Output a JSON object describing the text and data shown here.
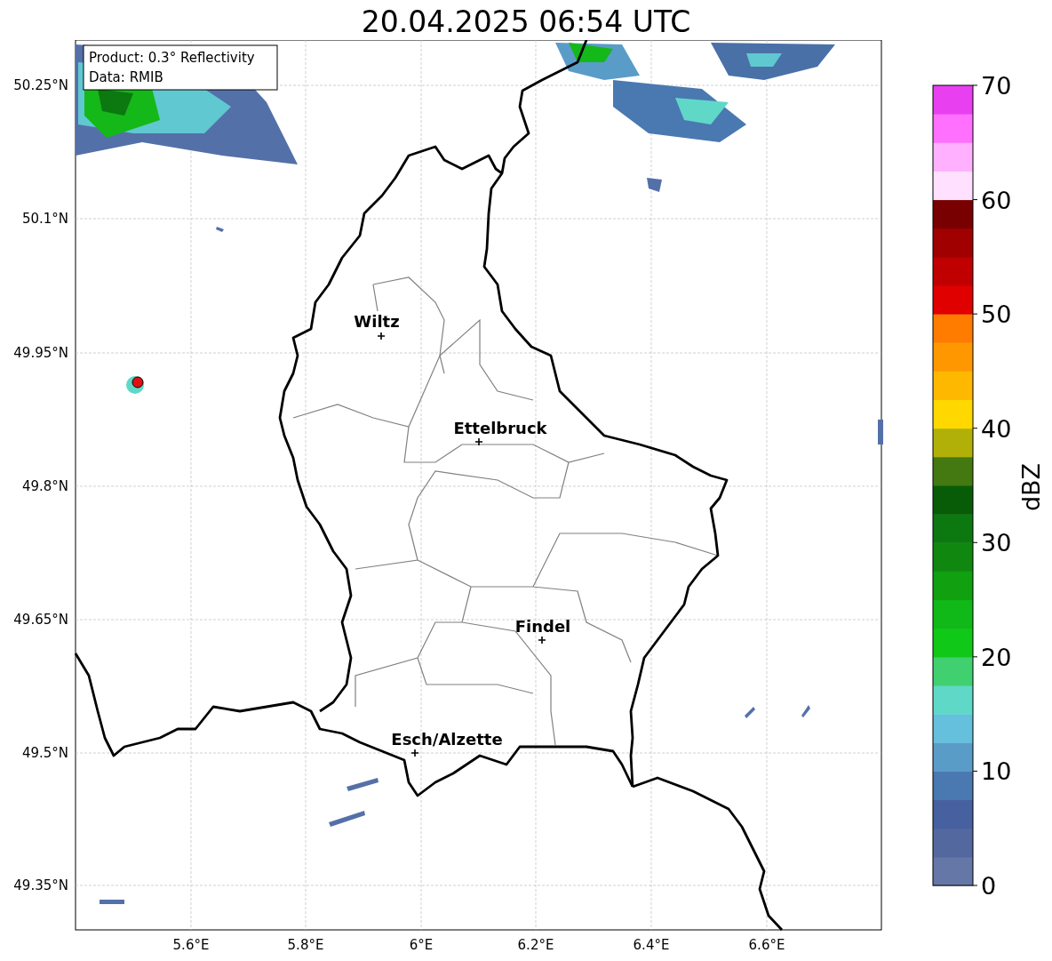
{
  "title": "20.04.2025 06:54 UTC",
  "info_box": [
    "Product: 0.3° Reflectivity",
    "Data: RMIB"
  ],
  "map": {
    "y_ticks": [
      "50.25°N",
      "50.1°N",
      "49.95°N",
      "49.8°N",
      "49.65°N",
      "49.5°N",
      "49.35°N"
    ],
    "x_ticks": [
      "5.6°E",
      "5.8°E",
      "6°E",
      "6.2°E",
      "6.4°E",
      "6.6°E"
    ],
    "cities": [
      {
        "name": "Wiltz"
      },
      {
        "name": "Ettelbruck"
      },
      {
        "name": "Findel"
      },
      {
        "name": "Esch/Alzette"
      }
    ]
  },
  "colorbar": {
    "label": "dBZ",
    "ticks": [
      "70",
      "60",
      "50",
      "40",
      "30",
      "20",
      "10",
      "0"
    ],
    "bins": [
      {
        "color": "#6577a6"
      },
      {
        "color": "#5468a0"
      },
      {
        "color": "#4660a0"
      },
      {
        "color": "#4a78b0"
      },
      {
        "color": "#5a9cc8"
      },
      {
        "color": "#64c0dc"
      },
      {
        "color": "#60d8c8"
      },
      {
        "color": "#40d070"
      },
      {
        "color": "#10c818"
      },
      {
        "color": "#10b818"
      },
      {
        "color": "#10a010"
      },
      {
        "color": "#108810"
      },
      {
        "color": "#0c7810"
      },
      {
        "color": "#085c08"
      },
      {
        "color": "#447810"
      },
      {
        "color": "#b0b008"
      },
      {
        "color": "#ffd800"
      },
      {
        "color": "#ffb800"
      },
      {
        "color": "#ff9800"
      },
      {
        "color": "#ff7c00"
      },
      {
        "color": "#e00000"
      },
      {
        "color": "#c00000"
      },
      {
        "color": "#a00000"
      },
      {
        "color": "#780000"
      },
      {
        "color": "#ffe0ff"
      },
      {
        "color": "#ffb0ff"
      },
      {
        "color": "#ff70ff"
      },
      {
        "color": "#e840f0"
      }
    ]
  }
}
